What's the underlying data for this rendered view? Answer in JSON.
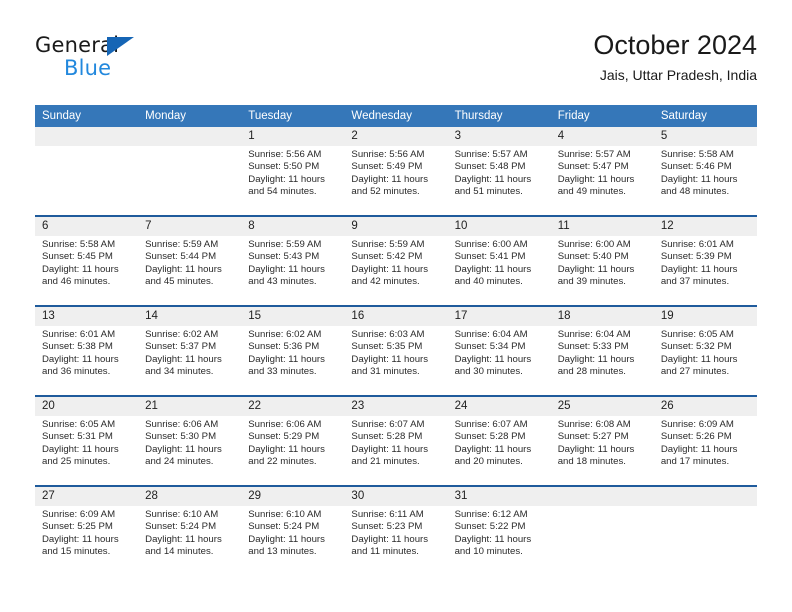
{
  "brand": {
    "line1": "General",
    "line2": "Blue",
    "triangle_color": "#1565b5",
    "blue_color": "#2288dd"
  },
  "header": {
    "title": "October 2024",
    "subtitle": "Jais, Uttar Pradesh, India"
  },
  "theme": {
    "header_row_bg": "#3577b9",
    "week_divider": "#1f5b9c",
    "daynum_bg": "#efefef"
  },
  "calendar": {
    "weekday_headers": [
      "Sunday",
      "Monday",
      "Tuesday",
      "Wednesday",
      "Thursday",
      "Friday",
      "Saturday"
    ],
    "weeks": [
      [
        {
          "day": "",
          "empty": true
        },
        {
          "day": "",
          "empty": true
        },
        {
          "day": "1",
          "sunrise": "Sunrise: 5:56 AM",
          "sunset": "Sunset: 5:50 PM",
          "daylight": "Daylight: 11 hours and 54 minutes."
        },
        {
          "day": "2",
          "sunrise": "Sunrise: 5:56 AM",
          "sunset": "Sunset: 5:49 PM",
          "daylight": "Daylight: 11 hours and 52 minutes."
        },
        {
          "day": "3",
          "sunrise": "Sunrise: 5:57 AM",
          "sunset": "Sunset: 5:48 PM",
          "daylight": "Daylight: 11 hours and 51 minutes."
        },
        {
          "day": "4",
          "sunrise": "Sunrise: 5:57 AM",
          "sunset": "Sunset: 5:47 PM",
          "daylight": "Daylight: 11 hours and 49 minutes."
        },
        {
          "day": "5",
          "sunrise": "Sunrise: 5:58 AM",
          "sunset": "Sunset: 5:46 PM",
          "daylight": "Daylight: 11 hours and 48 minutes."
        }
      ],
      [
        {
          "day": "6",
          "sunrise": "Sunrise: 5:58 AM",
          "sunset": "Sunset: 5:45 PM",
          "daylight": "Daylight: 11 hours and 46 minutes."
        },
        {
          "day": "7",
          "sunrise": "Sunrise: 5:59 AM",
          "sunset": "Sunset: 5:44 PM",
          "daylight": "Daylight: 11 hours and 45 minutes."
        },
        {
          "day": "8",
          "sunrise": "Sunrise: 5:59 AM",
          "sunset": "Sunset: 5:43 PM",
          "daylight": "Daylight: 11 hours and 43 minutes."
        },
        {
          "day": "9",
          "sunrise": "Sunrise: 5:59 AM",
          "sunset": "Sunset: 5:42 PM",
          "daylight": "Daylight: 11 hours and 42 minutes."
        },
        {
          "day": "10",
          "sunrise": "Sunrise: 6:00 AM",
          "sunset": "Sunset: 5:41 PM",
          "daylight": "Daylight: 11 hours and 40 minutes."
        },
        {
          "day": "11",
          "sunrise": "Sunrise: 6:00 AM",
          "sunset": "Sunset: 5:40 PM",
          "daylight": "Daylight: 11 hours and 39 minutes."
        },
        {
          "day": "12",
          "sunrise": "Sunrise: 6:01 AM",
          "sunset": "Sunset: 5:39 PM",
          "daylight": "Daylight: 11 hours and 37 minutes."
        }
      ],
      [
        {
          "day": "13",
          "sunrise": "Sunrise: 6:01 AM",
          "sunset": "Sunset: 5:38 PM",
          "daylight": "Daylight: 11 hours and 36 minutes."
        },
        {
          "day": "14",
          "sunrise": "Sunrise: 6:02 AM",
          "sunset": "Sunset: 5:37 PM",
          "daylight": "Daylight: 11 hours and 34 minutes."
        },
        {
          "day": "15",
          "sunrise": "Sunrise: 6:02 AM",
          "sunset": "Sunset: 5:36 PM",
          "daylight": "Daylight: 11 hours and 33 minutes."
        },
        {
          "day": "16",
          "sunrise": "Sunrise: 6:03 AM",
          "sunset": "Sunset: 5:35 PM",
          "daylight": "Daylight: 11 hours and 31 minutes."
        },
        {
          "day": "17",
          "sunrise": "Sunrise: 6:04 AM",
          "sunset": "Sunset: 5:34 PM",
          "daylight": "Daylight: 11 hours and 30 minutes."
        },
        {
          "day": "18",
          "sunrise": "Sunrise: 6:04 AM",
          "sunset": "Sunset: 5:33 PM",
          "daylight": "Daylight: 11 hours and 28 minutes."
        },
        {
          "day": "19",
          "sunrise": "Sunrise: 6:05 AM",
          "sunset": "Sunset: 5:32 PM",
          "daylight": "Daylight: 11 hours and 27 minutes."
        }
      ],
      [
        {
          "day": "20",
          "sunrise": "Sunrise: 6:05 AM",
          "sunset": "Sunset: 5:31 PM",
          "daylight": "Daylight: 11 hours and 25 minutes."
        },
        {
          "day": "21",
          "sunrise": "Sunrise: 6:06 AM",
          "sunset": "Sunset: 5:30 PM",
          "daylight": "Daylight: 11 hours and 24 minutes."
        },
        {
          "day": "22",
          "sunrise": "Sunrise: 6:06 AM",
          "sunset": "Sunset: 5:29 PM",
          "daylight": "Daylight: 11 hours and 22 minutes."
        },
        {
          "day": "23",
          "sunrise": "Sunrise: 6:07 AM",
          "sunset": "Sunset: 5:28 PM",
          "daylight": "Daylight: 11 hours and 21 minutes."
        },
        {
          "day": "24",
          "sunrise": "Sunrise: 6:07 AM",
          "sunset": "Sunset: 5:28 PM",
          "daylight": "Daylight: 11 hours and 20 minutes."
        },
        {
          "day": "25",
          "sunrise": "Sunrise: 6:08 AM",
          "sunset": "Sunset: 5:27 PM",
          "daylight": "Daylight: 11 hours and 18 minutes."
        },
        {
          "day": "26",
          "sunrise": "Sunrise: 6:09 AM",
          "sunset": "Sunset: 5:26 PM",
          "daylight": "Daylight: 11 hours and 17 minutes."
        }
      ],
      [
        {
          "day": "27",
          "sunrise": "Sunrise: 6:09 AM",
          "sunset": "Sunset: 5:25 PM",
          "daylight": "Daylight: 11 hours and 15 minutes."
        },
        {
          "day": "28",
          "sunrise": "Sunrise: 6:10 AM",
          "sunset": "Sunset: 5:24 PM",
          "daylight": "Daylight: 11 hours and 14 minutes."
        },
        {
          "day": "29",
          "sunrise": "Sunrise: 6:10 AM",
          "sunset": "Sunset: 5:24 PM",
          "daylight": "Daylight: 11 hours and 13 minutes."
        },
        {
          "day": "30",
          "sunrise": "Sunrise: 6:11 AM",
          "sunset": "Sunset: 5:23 PM",
          "daylight": "Daylight: 11 hours and 11 minutes."
        },
        {
          "day": "31",
          "sunrise": "Sunrise: 6:12 AM",
          "sunset": "Sunset: 5:22 PM",
          "daylight": "Daylight: 11 hours and 10 minutes."
        },
        {
          "day": "",
          "empty": true
        },
        {
          "day": "",
          "empty": true
        }
      ]
    ]
  }
}
